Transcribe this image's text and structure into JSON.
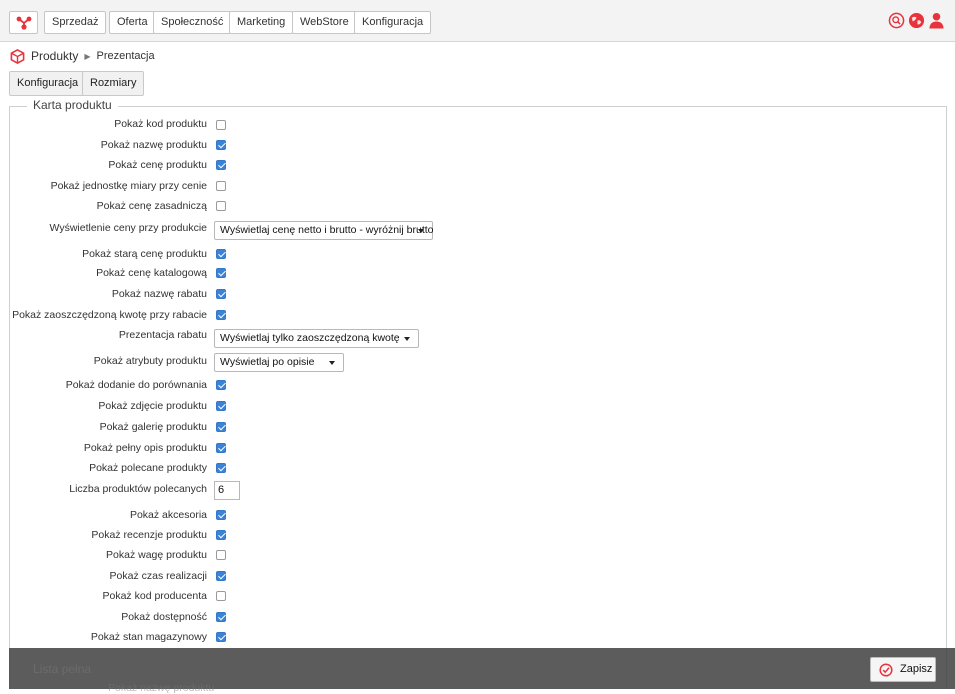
{
  "nav": {
    "items": [
      "Sprzedaż",
      "Oferta",
      "Społeczność",
      "Marketing",
      "WebStore",
      "Konfiguracja"
    ]
  },
  "breadcrumb": {
    "root": "Produkty",
    "current": "Prezentacja"
  },
  "subnav": {
    "config": "Konfiguracja",
    "sizes": "Rozmiary"
  },
  "section": {
    "legend": "Karta produktu",
    "rows": [
      {
        "label": "Pokaż kod produktu",
        "type": "checkbox",
        "checked": false
      },
      {
        "label": "Pokaż nazwę produktu",
        "type": "checkbox",
        "checked": true
      },
      {
        "label": "Pokaż cenę produktu",
        "type": "checkbox",
        "checked": true
      },
      {
        "label": "Pokaż jednostkę miary przy cenie",
        "type": "checkbox",
        "checked": false
      },
      {
        "label": "Pokaż cenę zasadniczą",
        "type": "checkbox",
        "checked": false
      },
      {
        "label": "Wyświetlenie ceny przy produkcie",
        "type": "select",
        "value": "Wyświetlaj cenę netto i brutto - wyróżnij brutto"
      },
      {
        "label": "Pokaż starą cenę produktu",
        "type": "checkbox",
        "checked": true
      },
      {
        "label": "Pokaż cenę katalogową",
        "type": "checkbox",
        "checked": true
      },
      {
        "label": "Pokaż nazwę rabatu",
        "type": "checkbox",
        "checked": true
      },
      {
        "label": "Pokaż zaoszczędzoną kwotę przy rabacie",
        "type": "checkbox",
        "checked": true
      },
      {
        "label": "Prezentacja rabatu",
        "type": "select",
        "value": "Wyświetlaj tylko zaoszczędzoną kwotę"
      },
      {
        "label": "Pokaż atrybuty produktu",
        "type": "select",
        "value": "Wyświetlaj po opisie"
      },
      {
        "label": "Pokaż dodanie do porównania",
        "type": "checkbox",
        "checked": true
      },
      {
        "label": "Pokaż zdjęcie produktu",
        "type": "checkbox",
        "checked": true
      },
      {
        "label": "Pokaż galerię produktu",
        "type": "checkbox",
        "checked": true
      },
      {
        "label": "Pokaż pełny opis produktu",
        "type": "checkbox",
        "checked": true
      },
      {
        "label": "Pokaż polecane produkty",
        "type": "checkbox",
        "checked": true
      },
      {
        "label": "Liczba produktów polecanych",
        "type": "number",
        "value": "6"
      },
      {
        "label": "Pokaż akcesoria",
        "type": "checkbox",
        "checked": true
      },
      {
        "label": "Pokaż recenzje produktu",
        "type": "checkbox",
        "checked": true
      },
      {
        "label": "Pokaż wagę produktu",
        "type": "checkbox",
        "checked": false
      },
      {
        "label": "Pokaż czas realizacji",
        "type": "checkbox",
        "checked": true
      },
      {
        "label": "Pokaż kod producenta",
        "type": "checkbox",
        "checked": false
      },
      {
        "label": "Pokaż dostępność",
        "type": "checkbox",
        "checked": true
      },
      {
        "label": "Pokaż stan magazynowy",
        "type": "checkbox",
        "checked": true
      }
    ]
  },
  "section2": {
    "legend": "Lista pełna",
    "first_row": "Pokaż nazwę produktu"
  },
  "footer": {
    "save": "Zapisz"
  },
  "colors": {
    "accent": "#e8323c",
    "checkbox": "#3b83d6"
  },
  "icons": [
    "logo-icon",
    "cube-icon",
    "search-icon",
    "globe-icon",
    "user-icon",
    "save-circle-icon"
  ]
}
